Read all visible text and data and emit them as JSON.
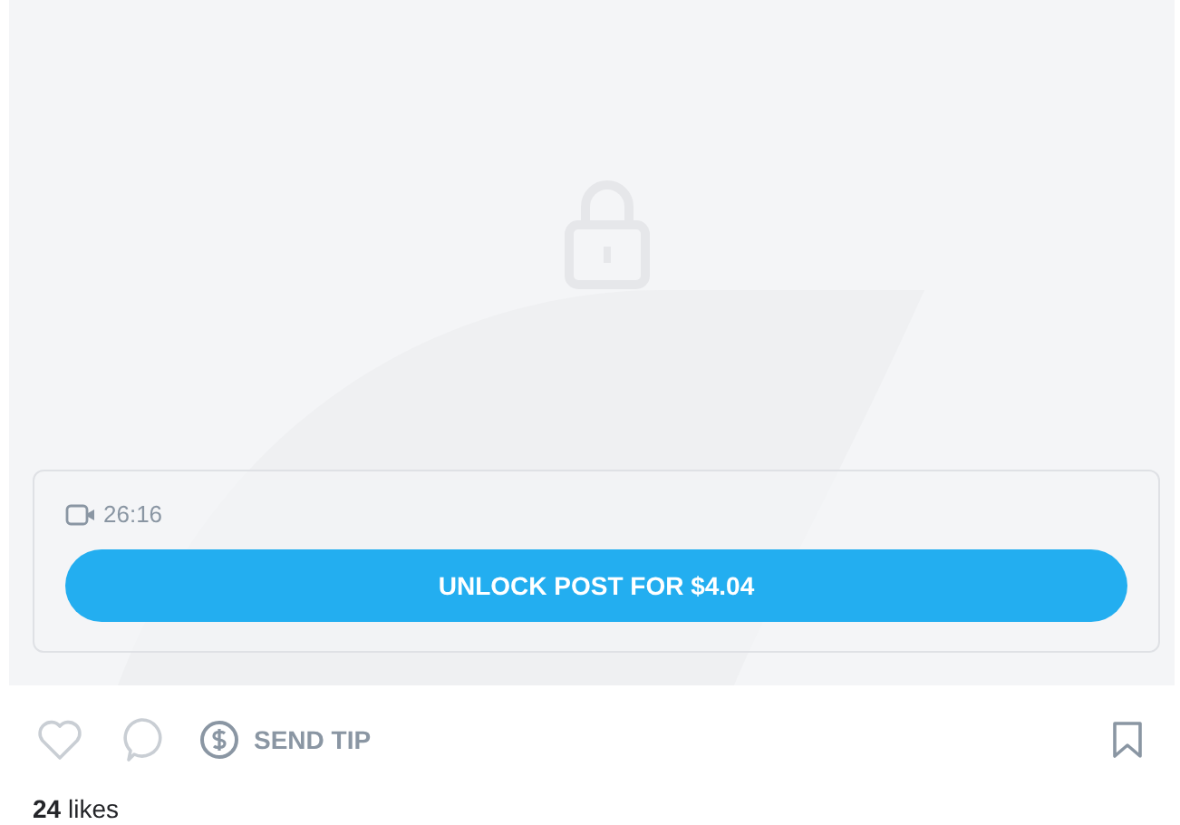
{
  "locked_media": {
    "duration": "26:16",
    "unlock_button": "UNLOCK POST FOR $4.04"
  },
  "actions": {
    "send_tip": "SEND TIP"
  },
  "likes": "**24** likes"
}
